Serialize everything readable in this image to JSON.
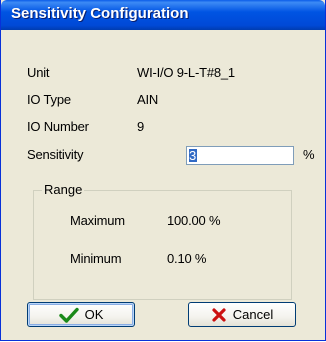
{
  "window": {
    "title": "Sensitivity Configuration"
  },
  "fields": {
    "unit": {
      "label": "Unit",
      "value": "WI-I/O 9-L-T#8_1"
    },
    "io_type": {
      "label": "IO Type",
      "value": "AIN"
    },
    "io_number": {
      "label": "IO Number",
      "value": "9"
    },
    "sensitivity": {
      "label": "Sensitivity",
      "value": "3",
      "unit": "%"
    }
  },
  "range": {
    "label": "Range",
    "maximum": {
      "label": "Maximum",
      "value": "100.00 %"
    },
    "minimum": {
      "label": "Minimum",
      "value": "0.10 %"
    }
  },
  "buttons": {
    "ok": {
      "label": "OK",
      "icon": "checkmark-icon",
      "icon_color": "#1a8a1a"
    },
    "cancel": {
      "label": "Cancel",
      "icon": "x-icon",
      "icon_color": "#cc1010"
    }
  },
  "colors": {
    "titlebar": "#0054e3",
    "dialog_bg": "#ece9d8"
  }
}
